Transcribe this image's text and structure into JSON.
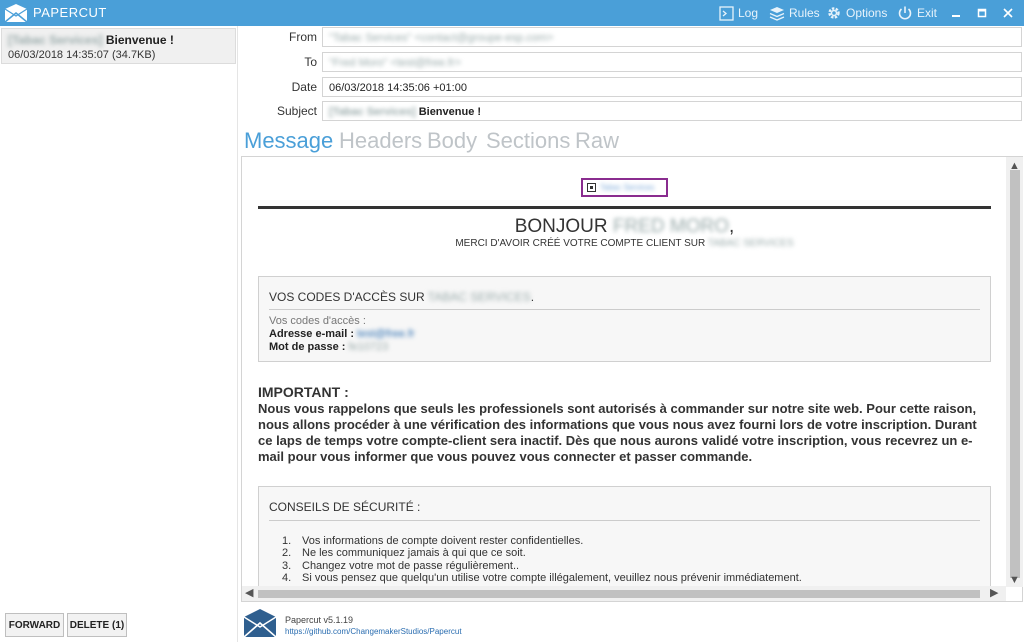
{
  "app": {
    "title": "PAPERCUT",
    "toolbar": {
      "log": "Log",
      "rules": "Rules",
      "options": "Options",
      "exit": "Exit"
    },
    "version": "Papercut v5.1.19",
    "link": "https://github.com/ChangemakerStudios/Papercut"
  },
  "message_list": [
    {
      "subject_blurred": "[Tabac Services]",
      "subject": "Bienvenue !",
      "meta": "06/03/2018 14:35:07 (34.7KB)"
    }
  ],
  "actions": {
    "forward": "FORWARD",
    "delete": "DELETE (1)"
  },
  "headers": {
    "from_label": "From",
    "from_value": "\"Tabac Services\" <contact@groupe-esp.com>",
    "to_label": "To",
    "to_value": "\"Fred Moro\" <test@free.fr>",
    "date_label": "Date",
    "date_value": "06/03/2018 14:35:06 +01:00",
    "subject_label": "Subject",
    "subject_blurred": "[Tabac Services]",
    "subject_value": "Bienvenue !"
  },
  "tabs": [
    "Message",
    "Headers",
    "Body",
    "Sections",
    "Raw"
  ],
  "email": {
    "logo_alt": "Tabac Services",
    "greeting": "BONJOUR",
    "greeting_name": "FRED MORO",
    "greeting_suffix": ",",
    "thanks": "MERCI D'AVOIR CRÉÉ VOTRE COMPTE CLIENT SUR",
    "thanks_blurred": "TABAC SERVICES",
    "codes_title": "VOS CODES D'ACCÈS SUR",
    "codes_title_blurred": "TABAC SERVICES",
    "codes_title_suffix": ".",
    "codes_intro": "Vos codes d'accès :",
    "email_label": "Adresse e-mail :",
    "email_value": "test@free.fr",
    "password_label": "Mot de passe :",
    "password_value": "fe10723",
    "important_title": "IMPORTANT :",
    "important_text": "Nous vous rappelons que seuls les professionels sont autorisés à commander sur notre site web. Pour cette raison, nous allons procéder à une vérification des informations que vous nous avez fourni lors de votre inscription. Durant ce laps de temps votre compte-client sera inactif. Dès que nous aurons validé votre inscription, vous recevrez un e-mail pour vous informer que vous pouvez vous connecter et passer commande.",
    "tips_title": "CONSEILS DE SÉCURITÉ :",
    "tips": [
      {
        "n": "1.",
        "text": "Vos informations de compte doivent rester confidentielles."
      },
      {
        "n": "2.",
        "text": "Ne les communiquez jamais à qui que ce soit."
      },
      {
        "n": "3.",
        "text": "Changez votre mot de passe régulièrement.."
      },
      {
        "n": "4.",
        "text": "Si vous pensez que quelqu'un utilise votre compte illégalement, veuillez nous prévenir immédiatement."
      }
    ]
  },
  "colors": {
    "accent": "#4a9fd8",
    "logo_border": "#8a2c8f"
  }
}
